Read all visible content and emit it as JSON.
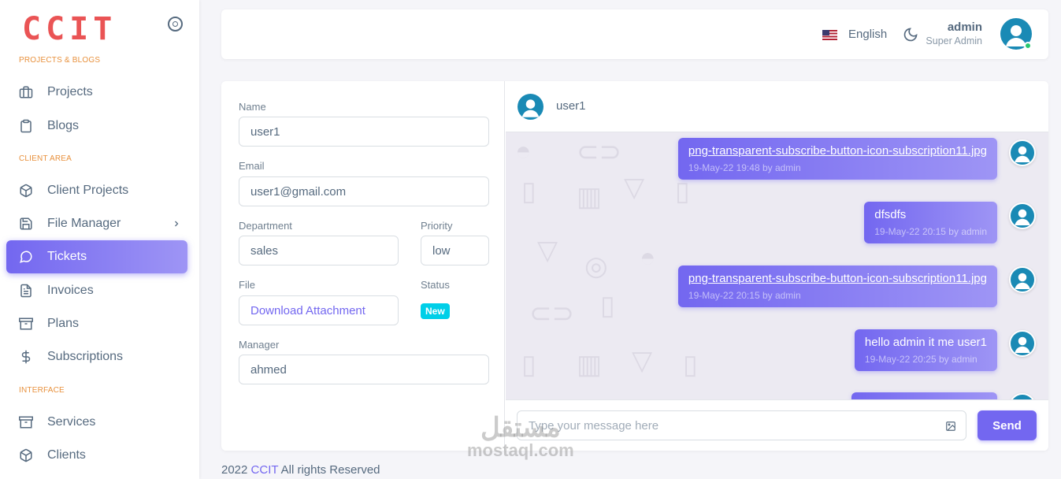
{
  "brand": {
    "logo": "CCIT"
  },
  "sidebar": {
    "sections": [
      {
        "title": "PROJECTS & BLOGS"
      },
      {
        "title": "CLIENT AREA"
      },
      {
        "title": "INTERFACE"
      }
    ],
    "items": [
      {
        "label": "Projects",
        "icon": "briefcase-icon"
      },
      {
        "label": "Blogs",
        "icon": "clipboard-icon"
      },
      {
        "label": "Client Projects",
        "icon": "box-icon"
      },
      {
        "label": "File Manager",
        "icon": "save-icon"
      },
      {
        "label": "Tickets",
        "icon": "message-circle-icon",
        "active": true
      },
      {
        "label": "Invoices",
        "icon": "file-text-icon"
      },
      {
        "label": "Plans",
        "icon": "archive-icon"
      },
      {
        "label": "Subscriptions",
        "icon": "dollar-icon"
      },
      {
        "label": "Services",
        "icon": "archive-icon"
      },
      {
        "label": "Clients",
        "icon": "box-icon"
      }
    ]
  },
  "header": {
    "language": "English",
    "user_name": "admin",
    "user_role": "Super Admin"
  },
  "form": {
    "name_label": "Name",
    "name_value": "user1",
    "email_label": "Email",
    "email_value": "user1@gmail.com",
    "department_label": "Department",
    "department_value": "sales",
    "priority_label": "Priority",
    "priority_value": "low",
    "file_label": "File",
    "file_link": "Download Attachment",
    "status_label": "Status",
    "status_value": "New",
    "manager_label": "Manager",
    "manager_value": "ahmed"
  },
  "chat": {
    "user": "user1",
    "messages": [
      {
        "text": "png-transparent-subscribe-button-icon-subscription11.jpg",
        "meta": "19-May-22 19:48 by admin",
        "is_file": true
      },
      {
        "text": "dfsdfs",
        "meta": "19-May-22 20:15 by admin",
        "is_file": false
      },
      {
        "text": "png-transparent-subscribe-button-icon-subscription11.jpg",
        "meta": "19-May-22 20:15 by admin",
        "is_file": true
      },
      {
        "text": "hello admin it me user1",
        "meta": "19-May-22 20:25 by admin",
        "is_file": false
      }
    ],
    "input_placeholder": "Type your message here",
    "send_label": "Send"
  },
  "footer": {
    "year": "2022",
    "brand": "CCIT",
    "rights": "All rights Reserved"
  },
  "watermark": {
    "line1": "مستقل",
    "line2": "mostaql.com"
  },
  "colors": {
    "accent": "#7367f0",
    "logo": "#ea5455",
    "section": "#e8913d",
    "badge": "#00cfe8",
    "online": "#28c76f"
  }
}
